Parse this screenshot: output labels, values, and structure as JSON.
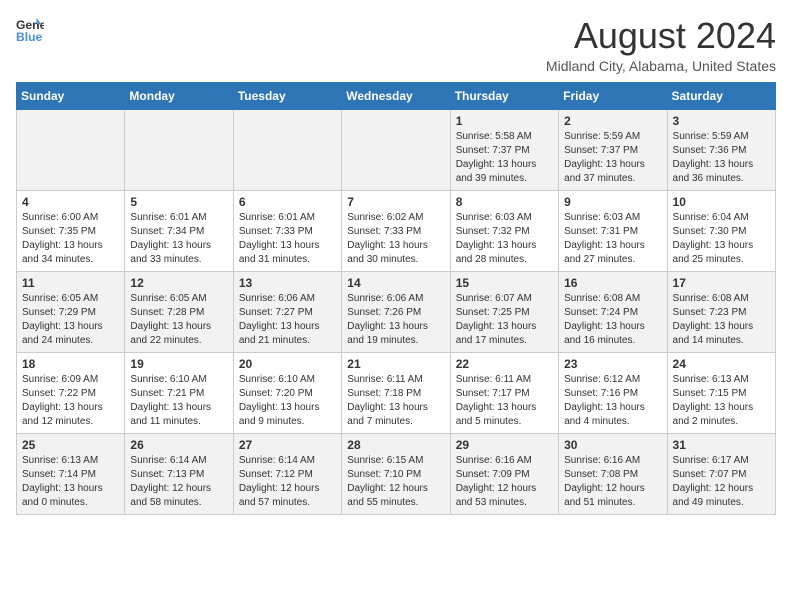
{
  "header": {
    "logo_line1": "General",
    "logo_line2": "Blue",
    "title": "August 2024",
    "subtitle": "Midland City, Alabama, United States"
  },
  "weekdays": [
    "Sunday",
    "Monday",
    "Tuesday",
    "Wednesday",
    "Thursday",
    "Friday",
    "Saturday"
  ],
  "weeks": [
    [
      {
        "day": "",
        "info": ""
      },
      {
        "day": "",
        "info": ""
      },
      {
        "day": "",
        "info": ""
      },
      {
        "day": "",
        "info": ""
      },
      {
        "day": "1",
        "info": "Sunrise: 5:58 AM\nSunset: 7:37 PM\nDaylight: 13 hours\nand 39 minutes."
      },
      {
        "day": "2",
        "info": "Sunrise: 5:59 AM\nSunset: 7:37 PM\nDaylight: 13 hours\nand 37 minutes."
      },
      {
        "day": "3",
        "info": "Sunrise: 5:59 AM\nSunset: 7:36 PM\nDaylight: 13 hours\nand 36 minutes."
      }
    ],
    [
      {
        "day": "4",
        "info": "Sunrise: 6:00 AM\nSunset: 7:35 PM\nDaylight: 13 hours\nand 34 minutes."
      },
      {
        "day": "5",
        "info": "Sunrise: 6:01 AM\nSunset: 7:34 PM\nDaylight: 13 hours\nand 33 minutes."
      },
      {
        "day": "6",
        "info": "Sunrise: 6:01 AM\nSunset: 7:33 PM\nDaylight: 13 hours\nand 31 minutes."
      },
      {
        "day": "7",
        "info": "Sunrise: 6:02 AM\nSunset: 7:33 PM\nDaylight: 13 hours\nand 30 minutes."
      },
      {
        "day": "8",
        "info": "Sunrise: 6:03 AM\nSunset: 7:32 PM\nDaylight: 13 hours\nand 28 minutes."
      },
      {
        "day": "9",
        "info": "Sunrise: 6:03 AM\nSunset: 7:31 PM\nDaylight: 13 hours\nand 27 minutes."
      },
      {
        "day": "10",
        "info": "Sunrise: 6:04 AM\nSunset: 7:30 PM\nDaylight: 13 hours\nand 25 minutes."
      }
    ],
    [
      {
        "day": "11",
        "info": "Sunrise: 6:05 AM\nSunset: 7:29 PM\nDaylight: 13 hours\nand 24 minutes."
      },
      {
        "day": "12",
        "info": "Sunrise: 6:05 AM\nSunset: 7:28 PM\nDaylight: 13 hours\nand 22 minutes."
      },
      {
        "day": "13",
        "info": "Sunrise: 6:06 AM\nSunset: 7:27 PM\nDaylight: 13 hours\nand 21 minutes."
      },
      {
        "day": "14",
        "info": "Sunrise: 6:06 AM\nSunset: 7:26 PM\nDaylight: 13 hours\nand 19 minutes."
      },
      {
        "day": "15",
        "info": "Sunrise: 6:07 AM\nSunset: 7:25 PM\nDaylight: 13 hours\nand 17 minutes."
      },
      {
        "day": "16",
        "info": "Sunrise: 6:08 AM\nSunset: 7:24 PM\nDaylight: 13 hours\nand 16 minutes."
      },
      {
        "day": "17",
        "info": "Sunrise: 6:08 AM\nSunset: 7:23 PM\nDaylight: 13 hours\nand 14 minutes."
      }
    ],
    [
      {
        "day": "18",
        "info": "Sunrise: 6:09 AM\nSunset: 7:22 PM\nDaylight: 13 hours\nand 12 minutes."
      },
      {
        "day": "19",
        "info": "Sunrise: 6:10 AM\nSunset: 7:21 PM\nDaylight: 13 hours\nand 11 minutes."
      },
      {
        "day": "20",
        "info": "Sunrise: 6:10 AM\nSunset: 7:20 PM\nDaylight: 13 hours\nand 9 minutes."
      },
      {
        "day": "21",
        "info": "Sunrise: 6:11 AM\nSunset: 7:18 PM\nDaylight: 13 hours\nand 7 minutes."
      },
      {
        "day": "22",
        "info": "Sunrise: 6:11 AM\nSunset: 7:17 PM\nDaylight: 13 hours\nand 5 minutes."
      },
      {
        "day": "23",
        "info": "Sunrise: 6:12 AM\nSunset: 7:16 PM\nDaylight: 13 hours\nand 4 minutes."
      },
      {
        "day": "24",
        "info": "Sunrise: 6:13 AM\nSunset: 7:15 PM\nDaylight: 13 hours\nand 2 minutes."
      }
    ],
    [
      {
        "day": "25",
        "info": "Sunrise: 6:13 AM\nSunset: 7:14 PM\nDaylight: 13 hours\nand 0 minutes."
      },
      {
        "day": "26",
        "info": "Sunrise: 6:14 AM\nSunset: 7:13 PM\nDaylight: 12 hours\nand 58 minutes."
      },
      {
        "day": "27",
        "info": "Sunrise: 6:14 AM\nSunset: 7:12 PM\nDaylight: 12 hours\nand 57 minutes."
      },
      {
        "day": "28",
        "info": "Sunrise: 6:15 AM\nSunset: 7:10 PM\nDaylight: 12 hours\nand 55 minutes."
      },
      {
        "day": "29",
        "info": "Sunrise: 6:16 AM\nSunset: 7:09 PM\nDaylight: 12 hours\nand 53 minutes."
      },
      {
        "day": "30",
        "info": "Sunrise: 6:16 AM\nSunset: 7:08 PM\nDaylight: 12 hours\nand 51 minutes."
      },
      {
        "day": "31",
        "info": "Sunrise: 6:17 AM\nSunset: 7:07 PM\nDaylight: 12 hours\nand 49 minutes."
      }
    ]
  ]
}
